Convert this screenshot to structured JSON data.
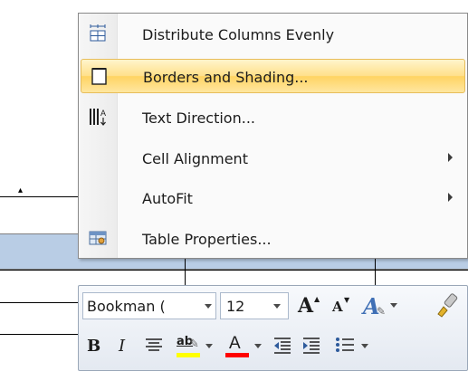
{
  "context_menu": {
    "items": [
      {
        "label": "Distribute Columns Evenly",
        "icon": "distribute-columns-icon",
        "submenu": false,
        "hover": false
      },
      {
        "label": "Borders and Shading...",
        "icon": "borders-shading-icon",
        "submenu": false,
        "hover": true
      },
      {
        "label": "Text Direction...",
        "icon": "text-direction-icon",
        "submenu": false,
        "hover": false
      },
      {
        "label": "Cell Alignment",
        "icon": "",
        "submenu": true,
        "hover": false
      },
      {
        "label": "AutoFit",
        "icon": "",
        "submenu": true,
        "hover": false
      },
      {
        "label": "Table Properties...",
        "icon": "table-properties-icon",
        "submenu": false,
        "hover": false
      }
    ]
  },
  "mini_toolbar": {
    "font_name": "Bookman (",
    "font_size": "12",
    "bold_label": "B",
    "italic_label": "I",
    "grow_font_label": "A",
    "shrink_font_label": "A",
    "font_color_label": "A",
    "highlight_label": "ab",
    "highlight_color": "#ffff00",
    "font_color": "#ff0000"
  },
  "colors": {
    "menu_hover": "#ffd462",
    "selected_row": "#b9cde5"
  }
}
